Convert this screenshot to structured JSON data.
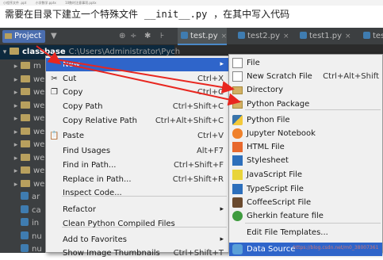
{
  "top_strip": [
    "小程序文件 .ppt",
    "小学数学.pptx",
    "10数时注意事项.pptx"
  ],
  "caption": {
    "prefix": "需要在目录下建立一个特殊文件",
    "code": "__init__.py",
    "suffix": "，在其中写入代码"
  },
  "project_bar": {
    "tab": "Project",
    "dropdown_icon": "▼",
    "icons": [
      "⊕",
      "÷",
      "✱",
      "⊦"
    ]
  },
  "editor_tabs": [
    {
      "label": "test.py",
      "active": true
    },
    {
      "label": "test2.py",
      "active": false
    },
    {
      "label": "test1.py",
      "active": false
    },
    {
      "label": "tes",
      "active": false
    }
  ],
  "tree": {
    "root": {
      "name": "classbase",
      "path": "C:\\Users\\Administrator\\Pych"
    },
    "items": [
      {
        "label": "m",
        "kind": "folder"
      },
      {
        "label": "we",
        "kind": "folder"
      },
      {
        "label": "we",
        "kind": "folder"
      },
      {
        "label": "we",
        "kind": "folder"
      },
      {
        "label": "we",
        "kind": "folder"
      },
      {
        "label": "we",
        "kind": "folder"
      },
      {
        "label": "we",
        "kind": "folder"
      },
      {
        "label": "we",
        "kind": "folder"
      },
      {
        "label": "we",
        "kind": "folder"
      },
      {
        "label": "we",
        "kind": "folder"
      },
      {
        "label": "ar",
        "kind": "file"
      },
      {
        "label": "ca",
        "kind": "file"
      },
      {
        "label": "in",
        "kind": "file"
      },
      {
        "label": "nu",
        "kind": "file"
      },
      {
        "label": "nu",
        "kind": "file"
      }
    ]
  },
  "context_menu": {
    "items": [
      {
        "label": "New",
        "shortcut": "",
        "submenu": true,
        "selected": true,
        "icon": ""
      },
      {
        "label": "Cut",
        "shortcut": "Ctrl+X",
        "icon": "cut-icon",
        "glyph": "✂"
      },
      {
        "label": "Copy",
        "shortcut": "Ctrl+C",
        "icon": "copy-icon",
        "glyph": "❐"
      },
      {
        "label": "Copy Path",
        "shortcut": "Ctrl+Shift+C",
        "icon": "",
        "glyph": ""
      },
      {
        "label": "Copy Relative Path",
        "shortcut": "Ctrl+Alt+Shift+C",
        "icon": "",
        "glyph": ""
      },
      {
        "label": "Paste",
        "shortcut": "Ctrl+V",
        "icon": "paste-icon",
        "glyph": "📋"
      },
      {
        "label": "Find Usages",
        "shortcut": "Alt+F7",
        "icon": "",
        "glyph": ""
      },
      {
        "label": "Find in Path...",
        "shortcut": "Ctrl+Shift+F",
        "icon": "",
        "glyph": ""
      },
      {
        "label": "Replace in Path...",
        "shortcut": "Ctrl+Shift+R",
        "icon": "",
        "glyph": ""
      },
      {
        "label": "Inspect Code...",
        "shortcut": "",
        "icon": "",
        "glyph": ""
      },
      {
        "label": "Refactor",
        "shortcut": "",
        "submenu": true,
        "icon": "",
        "glyph": ""
      },
      {
        "label": "Clean Python Compiled Files",
        "shortcut": "",
        "icon": "",
        "glyph": ""
      },
      {
        "label": "Add to Favorites",
        "shortcut": "",
        "submenu": true,
        "icon": "",
        "glyph": ""
      },
      {
        "label": "Show Image Thumbnails",
        "shortcut": "Ctrl+Shift+T",
        "icon": "",
        "glyph": ""
      }
    ]
  },
  "new_submenu": {
    "items": [
      {
        "label": "File",
        "shortcut": "",
        "icon": "file-icon"
      },
      {
        "label": "New Scratch File",
        "shortcut": "Ctrl+Alt+Shift",
        "icon": "scratch-file-icon"
      },
      {
        "label": "Directory",
        "shortcut": "",
        "icon": "directory-icon"
      },
      {
        "label": "Python Package",
        "shortcut": "",
        "icon": "python-package-icon"
      },
      {
        "label": "Python File",
        "shortcut": "",
        "icon": "python-file-icon"
      },
      {
        "label": "Jupyter Notebook",
        "shortcut": "",
        "icon": "jupyter-icon"
      },
      {
        "label": "HTML File",
        "shortcut": "",
        "icon": "html-file-icon"
      },
      {
        "label": "Stylesheet",
        "shortcut": "",
        "icon": "stylesheet-icon"
      },
      {
        "label": "JavaScript File",
        "shortcut": "",
        "icon": "javascript-file-icon"
      },
      {
        "label": "TypeScript File",
        "shortcut": "",
        "icon": "typescript-file-icon"
      },
      {
        "label": "CoffeeScript File",
        "shortcut": "",
        "icon": "coffeescript-file-icon"
      },
      {
        "label": "Gherkin feature file",
        "shortcut": "",
        "icon": "gherkin-icon"
      },
      {
        "label": "Edit File Templates...",
        "shortcut": "",
        "icon": ""
      },
      {
        "label": "Data Source",
        "shortcut": "",
        "icon": "data-source-icon",
        "selected": true
      }
    ]
  },
  "watermark": "https://blog.csdn.net/m0_38007361"
}
